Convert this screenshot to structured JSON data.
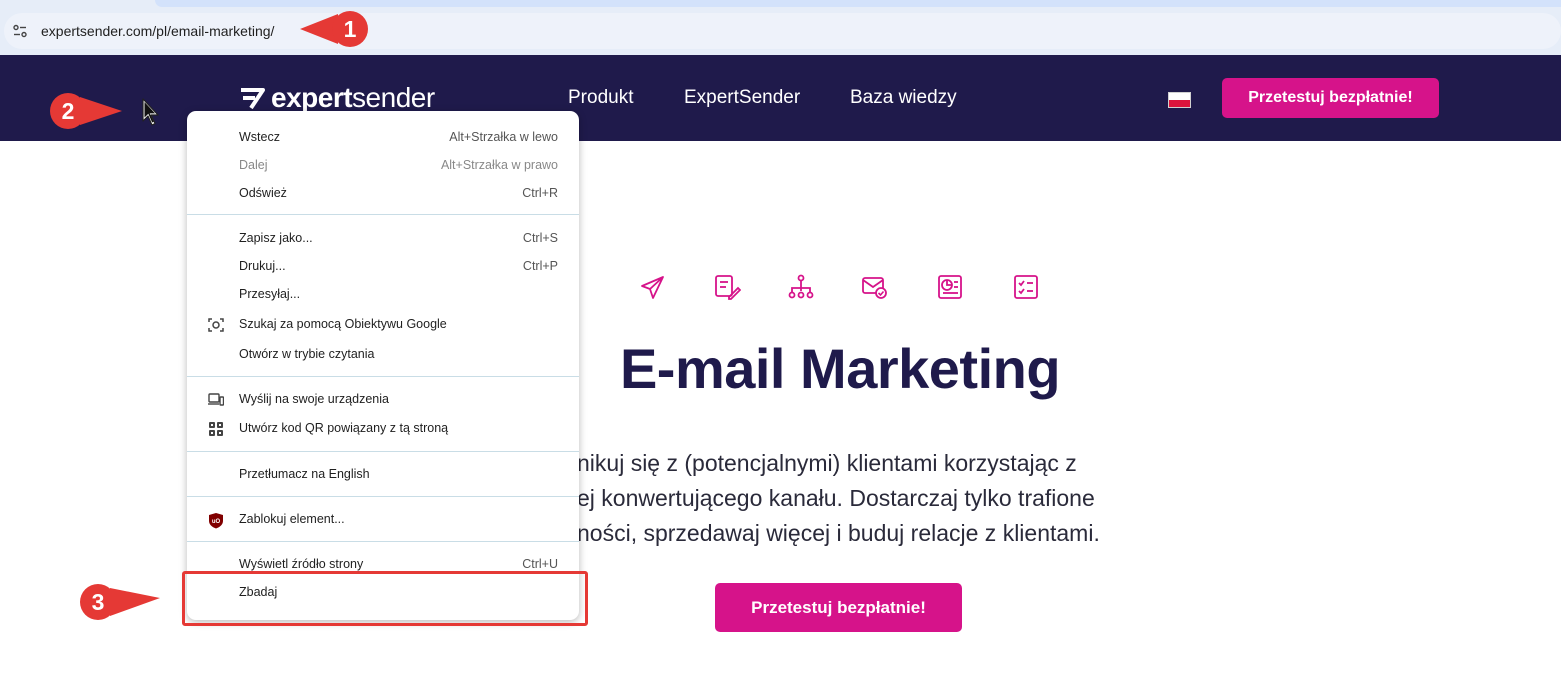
{
  "browser": {
    "url": "expertsender.com/pl/email-marketing/"
  },
  "site": {
    "logo_prefix": "expert",
    "logo_suffix": "sender",
    "nav": [
      "Produkt",
      "ExpertSender",
      "Baza wiedzy"
    ],
    "cta_label": "Przetestuj bezpłatnie!",
    "hero_icons": [
      "paper-plane-icon",
      "edit-form-icon",
      "workflow-tree-icon",
      "envelope-check-icon",
      "report-chart-icon",
      "checklist-icon"
    ],
    "hero_title": "E-mail Marketing",
    "hero_text_lines": [
      "nikuj się z (potencjalnymi) klientami korzystając z",
      "ej konwertującego kanału. Dostarczaj tylko trafione",
      "ności, sprzedawaj więcej i buduj relacje z klientami."
    ],
    "hero_cta": "Przetestuj bezpłatnie!",
    "brand_color": "#d6138a",
    "header_color": "#1f1a4b"
  },
  "context_menu": {
    "items": [
      {
        "label": "Wstecz",
        "shortcut": "Alt+Strzałka w lewo",
        "disabled": false
      },
      {
        "label": "Dalej",
        "shortcut": "Alt+Strzałka w prawo",
        "disabled": true
      },
      {
        "label": "Odśwież",
        "shortcut": "Ctrl+R",
        "disabled": false
      },
      {
        "label": "Zapisz jako...",
        "shortcut": "Ctrl+S",
        "disabled": false
      },
      {
        "label": "Drukuj...",
        "shortcut": "Ctrl+P",
        "disabled": false
      },
      {
        "label": "Przesyłaj...",
        "shortcut": "",
        "disabled": false
      },
      {
        "label": "Szukaj za pomocą Obiektywu Google",
        "shortcut": "",
        "disabled": false,
        "icon": "lens-icon"
      },
      {
        "label": "Otwórz w trybie czytania",
        "shortcut": "",
        "disabled": false
      },
      {
        "label": "Wyślij na swoje urządzenia",
        "shortcut": "",
        "disabled": false,
        "icon": "devices-icon"
      },
      {
        "label": "Utwórz kod QR powiązany z tą stroną",
        "shortcut": "",
        "disabled": false,
        "icon": "qr-code-icon"
      },
      {
        "label": "Przetłumacz na English",
        "shortcut": "",
        "disabled": false
      },
      {
        "label": "Zablokuj element...",
        "shortcut": "",
        "disabled": false,
        "icon": "ublock-icon"
      },
      {
        "label": "Wyświetl źródło strony",
        "shortcut": "Ctrl+U",
        "disabled": false
      },
      {
        "label": "Zbadaj",
        "shortcut": "",
        "disabled": false
      }
    ]
  },
  "annotations": {
    "badges": [
      "1",
      "2",
      "3"
    ],
    "badge_color": "#e53935"
  }
}
